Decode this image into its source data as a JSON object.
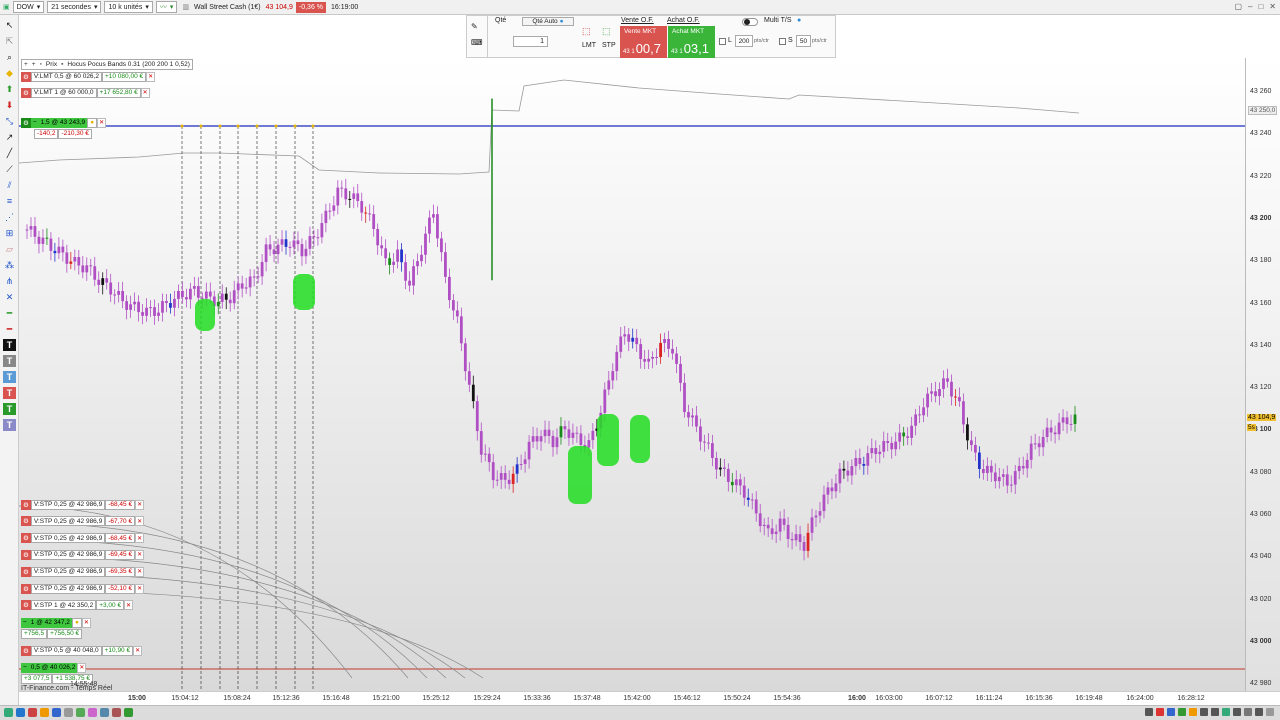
{
  "topbar": {
    "instrument_select": "DOW",
    "interval_select": "21 secondes",
    "size_select": "10 k unités",
    "market_name": "Wall Street Cash (1€)",
    "price": "43 104,9",
    "change": "-0,36 %",
    "time": "16:19:00"
  },
  "order_panel": {
    "qty_label": "Qté",
    "qty_auto_label": "Qté Auto",
    "qty_value": "1",
    "lmt_label": "LMT",
    "stp_label": "STP",
    "vente_of_label": "Vente O.F.",
    "achat_of_label": "Achat O.F.",
    "vente_mkt_label": "Vente MKT",
    "achat_mkt_label": "Achat MKT",
    "vente_price_small": "43 1",
    "vente_price_big": "00,7",
    "achat_price_small": "43 1",
    "achat_price_big": "03,1",
    "multi_ts_label": "Multi T/S",
    "l_label": "L",
    "l_value": "200",
    "l_unit": "pts/ctr",
    "s_label": "S",
    "s_value": "50",
    "s_unit": "pts/ctr"
  },
  "chart_header": {
    "prix_label": "Prix",
    "indicator_label": "Hocus Pocus Bands 0.31 (200 200 1 0,52)"
  },
  "orders_top": [
    {
      "text": "V:LMT 0,5 @ 60 026,2",
      "pnl": "+10 080,00 €"
    },
    {
      "text": "V:LMT 1 @ 60 000,0",
      "pnl": "+17 652,80 €"
    }
  ],
  "position_top": {
    "text": "1,5 @ 43 243,9",
    "pnl1": "-140,2",
    "pnl2": "-210,30 €"
  },
  "orders_bottom": [
    {
      "text": "V:STP 0,25 @ 42 986,9",
      "pnl": "-68,45 €"
    },
    {
      "text": "V:STP 0,25 @ 42 986,9",
      "pnl": "-67,70 €"
    },
    {
      "text": "V:STP 0,25 @ 42 986,9",
      "pnl": "-68,45 €"
    },
    {
      "text": "V:STP 0,25 @ 42 986,9",
      "pnl": "-69,45 €"
    },
    {
      "text": "V:STP 0,25 @ 42 986,9",
      "pnl": "-69,35 €"
    },
    {
      "text": "V:STP 0,25 @ 42 986,9",
      "pnl": "-52,10 €"
    },
    {
      "text": "V:STP 1 @ 42 350,2",
      "pnl": "+3,00 €"
    }
  ],
  "position_mid": {
    "text": "1 @ 42 347,2",
    "pnl1": "+756,5",
    "pnl2": "+756,50 €"
  },
  "order_stp_05": {
    "text": "V:STP 0,5 @ 40 048,0",
    "pnl": "+10,90 €"
  },
  "position_low": {
    "text": "0,5 @ 40 026,2",
    "pnl1": "+3 077,5",
    "pnl2": "+1 538,75 €"
  },
  "right_axis": {
    "labels": [
      "43 260",
      "43 240",
      "43 220",
      "43 200",
      "43 180",
      "43 160",
      "43 140",
      "43 120",
      "43 100",
      "43 080",
      "43 060",
      "43 040",
      "43 020",
      "43 000",
      "42 980"
    ],
    "current_price": "43 104,9",
    "band_value": "43 250,0",
    "flag_5s": "5s"
  },
  "bottom_axis": {
    "labels": [
      "15:00",
      "15:04:12",
      "15:08:24",
      "15:12:36",
      "15:16:48",
      "15:21:00",
      "15:25:12",
      "15:29:24",
      "15:33:36",
      "15:37:48",
      "15:42:00",
      "15:46:12",
      "15:50:24",
      "15:54:36",
      "16:00",
      "16:03:00",
      "16:07:12",
      "16:11:24",
      "16:15:36",
      "16:19:48",
      "16:24:00",
      "16:28:12"
    ],
    "left_time": "14:55:48"
  },
  "footer_text": "IT-Finance.com - Temps Réel",
  "chart_data": {
    "type": "candlestick",
    "y_axis": {
      "min": 42980,
      "max": 43260
    },
    "approx_closes": [
      43194,
      43190,
      43186,
      43182,
      43178,
      43176,
      43170,
      43166,
      43160,
      43157,
      43155,
      43156,
      43160,
      43163,
      43165,
      43162,
      43160,
      43162,
      43168,
      43170,
      43184,
      43186,
      43188,
      43184,
      43190,
      43200,
      43212,
      43210,
      43205,
      43195,
      43178,
      43182,
      43168,
      43185,
      43203,
      43170,
      43150,
      43120,
      43090,
      43078,
      43075,
      43080,
      43092,
      43098,
      43094,
      43100,
      43095,
      43092,
      43108,
      43130,
      43146,
      43138,
      43130,
      43140,
      43138,
      43110,
      43100,
      43090,
      43080,
      43075,
      43070,
      43060,
      43050,
      43055,
      43048,
      43045,
      43060,
      43070,
      43078,
      43082,
      43085,
      43090,
      43092,
      43095,
      43100,
      43112,
      43118,
      43122,
      43110,
      43090,
      43080,
      43078,
      43074,
      43080,
      43090,
      43096,
      43100,
      43104
    ]
  }
}
